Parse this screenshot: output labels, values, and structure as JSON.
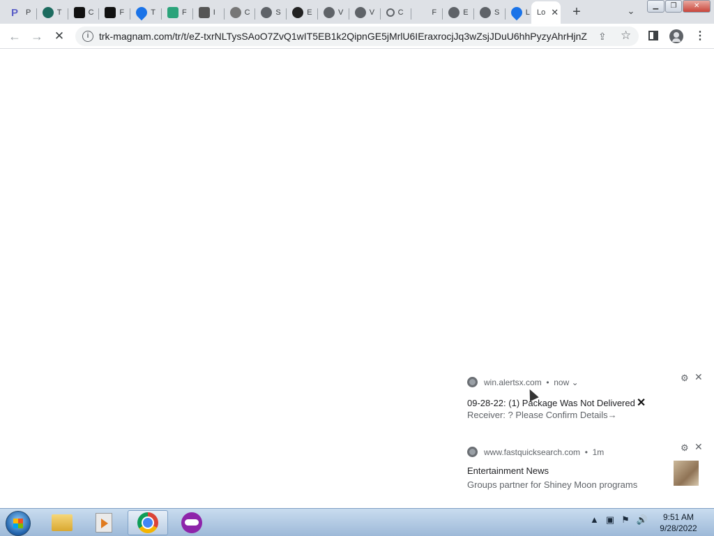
{
  "browser": {
    "tabs": [
      {
        "icon": "p-letter-icon",
        "label": "P",
        "color": "#5b5fc7"
      },
      {
        "icon": "ts-circle-icon",
        "label": "T",
        "color": "#1c6b5f"
      },
      {
        "icon": "dash-logo-icon",
        "label": "C",
        "color": "#111111"
      },
      {
        "icon": "dash-logo-icon",
        "label": "F",
        "color": "#111111"
      },
      {
        "icon": "location-pin-icon",
        "label": "T",
        "color": "#1a73e8"
      },
      {
        "icon": "gift-box-icon",
        "label": "F",
        "color": "#2aa37a"
      },
      {
        "icon": "link-pill-icon",
        "label": "I",
        "color": "#555555"
      },
      {
        "icon": "wifi-icon",
        "label": "C",
        "color": "#777777"
      },
      {
        "icon": "globe-icon",
        "label": "S",
        "color": "#5f6368"
      },
      {
        "icon": "dark-circle-icon",
        "label": "E",
        "color": "#222222"
      },
      {
        "icon": "globe-icon",
        "label": "V",
        "color": "#5f6368"
      },
      {
        "icon": "globe-icon",
        "label": "V",
        "color": "#5f6368"
      },
      {
        "icon": "search-icon",
        "label": "C",
        "color": "#5f6368"
      },
      {
        "icon": "blank-icon",
        "label": "F",
        "color": "#dee1e6"
      },
      {
        "icon": "globe-icon",
        "label": "E",
        "color": "#5f6368"
      },
      {
        "icon": "globe-icon",
        "label": "S",
        "color": "#5f6368"
      },
      {
        "icon": "location-pin-icon",
        "label": "L",
        "color": "#1a73e8"
      }
    ],
    "active_tab": {
      "label": "Lo"
    },
    "new_tab_symbol": "+",
    "tab_search_symbol": "⌄",
    "url": "trk-magnam.com/tr/t/eZ-txrNLTysSAoO7ZvQ1wIT5EB1k2QipnGE5jMrlU6IEraxrocjJq3wZsjJDuU6hhPyzyAhrHjnZ-...",
    "nav": {
      "back": "←",
      "forward": "→",
      "stop": "✕"
    }
  },
  "notifications": [
    {
      "source": "win.alertsx.com",
      "time": "now",
      "title": "09-28-22: (1) Package Was Not Delivered",
      "title_mark": "✕",
      "body": "Receiver: ? Please Confirm Details→"
    },
    {
      "source": "www.fastquicksearch.com",
      "time": "1m",
      "title": "Entertainment News",
      "body": "Groups partner for Shiney Moon programs"
    }
  ],
  "taskbar": {
    "clock_time": "9:51 AM",
    "clock_date": "9/28/2022"
  }
}
